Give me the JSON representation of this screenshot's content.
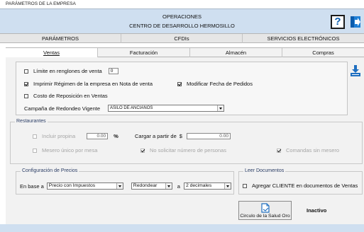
{
  "window": {
    "title": "PARÁMETROS DE LA EMPRESA"
  },
  "header": {
    "operacion": "OPERACIONES",
    "centro": "CENTRO DE DESARROLLO HERMOSILLO",
    "help_label": "?"
  },
  "main_tabs": [
    {
      "label": "PARÁMETROS"
    },
    {
      "label": "CFDIs"
    },
    {
      "label": "SERVICIOS ELECTRÓNICOS"
    }
  ],
  "sub_tabs": [
    {
      "label": "Ventas",
      "active": true
    },
    {
      "label": "Facturación"
    },
    {
      "label": "Almacén"
    },
    {
      "label": "Compras"
    }
  ],
  "ventas": {
    "limite_label": "Límite en renglones de venta",
    "limite_value": "0",
    "imprimir_label": "Imprimir Régimen de la empresa en Nota de venta",
    "modificar_label": "Modificar Fecha de Pedidos",
    "costo_label": "Costo de Reposición en Ventas",
    "campana_label": "Campaña de Redondeo Vigente",
    "campana_value": "ASILO DE ANCIANOS"
  },
  "restaurantes": {
    "legend": "Restaurantes",
    "incluir_label": "Incluir propina",
    "propina_value": "0.00",
    "percent": "%",
    "cargar_label": "Cargar a partir de",
    "currency": "$",
    "cargar_value": "0.00",
    "mesero_label": "Mesero único por mesa",
    "no_solicitar_label": "No solicitar número de personas",
    "comandas_label": "Comandas sin mesero"
  },
  "precios": {
    "legend": "Configuración de Precios",
    "en_base_label": "En base a",
    "base_value": "Precio con Impuestos",
    "redondear_value": "Redondear",
    "a_label": "a",
    "decimales_value": "2 decimales"
  },
  "documentos": {
    "legend": "Leer Documentos",
    "agregar_label": "Agregar CLIENTE en documentos de Ventas"
  },
  "footer": {
    "circulo_label": "Circulo de la Salud Oro",
    "status": "Inactivo"
  },
  "colors": {
    "header_bg": "#cfdff0",
    "icon_blue": "#0b5cad"
  }
}
